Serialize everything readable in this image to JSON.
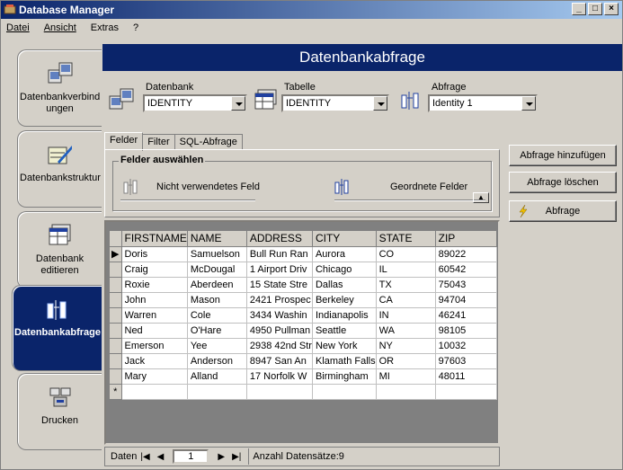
{
  "window": {
    "title": "Database Manager"
  },
  "menu": [
    {
      "label": "Datei"
    },
    {
      "label": "Ansicht"
    },
    {
      "label": "Extras"
    },
    {
      "label": "?"
    }
  ],
  "nav": [
    {
      "label": "Datenbankverbindungen",
      "icon": "database-connect-icon"
    },
    {
      "label": "Datenbankstruktur",
      "icon": "structure-icon"
    },
    {
      "label": "Datenbank editieren",
      "icon": "table-edit-icon"
    },
    {
      "label": "Datenbankabfrage",
      "icon": "query-icon",
      "active": true
    },
    {
      "label": "Drucken",
      "icon": "printer-icon"
    }
  ],
  "header": {
    "title": "Datenbankabfrage"
  },
  "selectors": {
    "datenbank": {
      "label": "Datenbank",
      "value": "IDENTITY"
    },
    "tabelle": {
      "label": "Tabelle",
      "value": "IDENTITY"
    },
    "abfrage": {
      "label": "Abfrage",
      "value": "Identity 1"
    }
  },
  "tabs": [
    {
      "label": "Felder",
      "active": true
    },
    {
      "label": "Filter"
    },
    {
      "label": "SQL-Abfrage"
    }
  ],
  "fields_group": {
    "title": "Felder auswählen",
    "unused": "Nicht verwendetes Feld",
    "ordered": "Geordnete Felder"
  },
  "actions": {
    "add": "Abfrage hinzufügen",
    "delete": "Abfrage löschen",
    "run": "Abfrage"
  },
  "grid": {
    "columns": [
      "FIRSTNAME",
      "NAME",
      "ADDRESS",
      "CITY",
      "STATE",
      "ZIP"
    ],
    "rows": [
      [
        "Doris",
        "Samuelson",
        "Bull Run Ran",
        "Aurora",
        "CO",
        "89022"
      ],
      [
        "Craig",
        "McDougal",
        "1 Airport Driv",
        "Chicago",
        "IL",
        "60542"
      ],
      [
        "Roxie",
        "Aberdeen",
        "15 State Stre",
        "Dallas",
        "TX",
        "75043"
      ],
      [
        "John",
        "Mason",
        "2421 Prospec",
        "Berkeley",
        "CA",
        "94704"
      ],
      [
        "Warren",
        "Cole",
        "3434 Washin",
        "Indianapolis",
        "IN",
        "46241"
      ],
      [
        "Ned",
        "O'Hare",
        "4950 Pullman",
        "Seattle",
        "WA",
        "98105"
      ],
      [
        "Emerson",
        "Yee",
        "2938 42nd Str",
        "New York",
        "NY",
        "10032"
      ],
      [
        "Jack",
        "Anderson",
        "8947 San An",
        "Klamath Falls",
        "OR",
        "97603"
      ],
      [
        "Mary",
        "Alland",
        "17 Norfolk W",
        "Birmingham",
        "MI",
        "48011"
      ]
    ],
    "new_row_marker": "*",
    "current_marker": "▶"
  },
  "navigator": {
    "label": "Daten",
    "record": "1",
    "count_text": "Anzahl Datensätze:9"
  },
  "colors": {
    "accent": "#0a246a",
    "face": "#d4d0c8"
  }
}
